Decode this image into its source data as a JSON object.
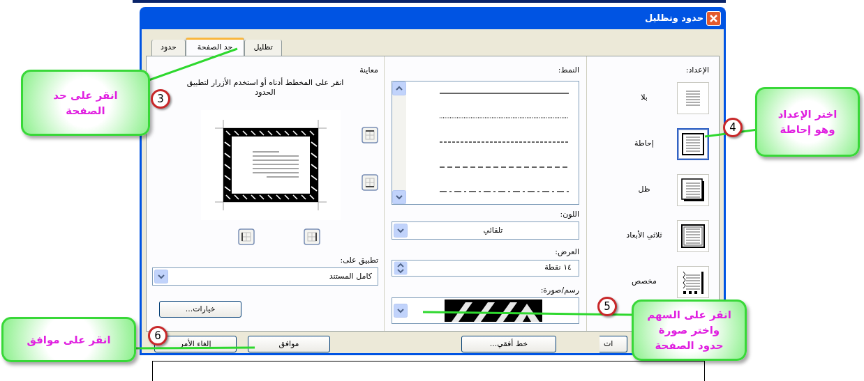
{
  "dialog": {
    "title": "حدود وتظليل",
    "tabs": [
      {
        "label": "تظليل",
        "selected": false
      },
      {
        "label": "حد الصفحة",
        "selected": true
      },
      {
        "label": "حدود",
        "selected": false
      }
    ],
    "setting": {
      "label": "الإعداد:",
      "options": [
        {
          "kind": "none",
          "label": "بلا",
          "selected": false
        },
        {
          "kind": "box",
          "label": "إحاطة",
          "selected": true
        },
        {
          "kind": "shadow",
          "label": "ظل",
          "selected": false
        },
        {
          "kind": "threed",
          "label": "ثلاثي الأبعاد",
          "selected": false
        },
        {
          "kind": "custom",
          "label": "مخصص",
          "selected": false
        }
      ]
    },
    "style": {
      "label": "النمط:",
      "lines": [
        {
          "kind": "solid"
        },
        {
          "kind": "dotted"
        },
        {
          "kind": "dashed"
        },
        {
          "kind": "dashed-wide"
        },
        {
          "kind": "dash-dot"
        }
      ]
    },
    "color": {
      "label": "اللون:",
      "value": "تلقائي"
    },
    "width": {
      "label": "العرض:",
      "value": "١٤ نقطة"
    },
    "art": {
      "label": "رسم/صورة:"
    },
    "preview": {
      "label": "معاينة",
      "hint": "انقر على المخطط أدناه أو استخدم الأزرار لتطبيق الحدود"
    },
    "apply_to": {
      "label": "تطبيق على:",
      "value": "كامل المستند"
    },
    "options_button": "خيارات...",
    "buttons_right": [
      "ات",
      "خط أفقي..."
    ],
    "buttons_left": [
      "موافق",
      "إلغاء الأمر"
    ]
  },
  "callouts": [
    {
      "number": "3",
      "lines": [
        "انقر على حد",
        "الصفحة"
      ]
    },
    {
      "number": "4",
      "lines": [
        "اختر الإعداد",
        "وهو إحاطة"
      ]
    },
    {
      "number": "5",
      "lines": [
        "انقر على السهم",
        "واختر صورة",
        "حدود الصفحة"
      ]
    },
    {
      "number": "6",
      "lines": [
        "انقر على موافق"
      ]
    }
  ]
}
